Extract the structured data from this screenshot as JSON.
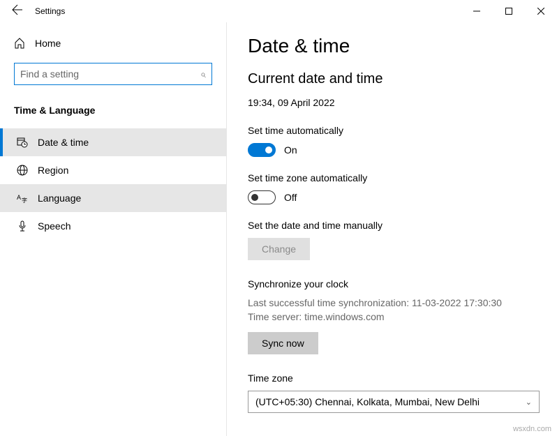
{
  "titlebar": {
    "title": "Settings"
  },
  "sidebar": {
    "home": "Home",
    "search_placeholder": "Find a setting",
    "group": "Time & Language",
    "items": [
      {
        "label": "Date & time"
      },
      {
        "label": "Region"
      },
      {
        "label": "Language"
      },
      {
        "label": "Speech"
      }
    ]
  },
  "main": {
    "heading": "Date & time",
    "subheading": "Current date and time",
    "datetime": "19:34, 09 April 2022",
    "set_time_auto_label": "Set time automatically",
    "set_time_auto_state": "On",
    "set_tz_auto_label": "Set time zone automatically",
    "set_tz_auto_state": "Off",
    "manual_label": "Set the date and time manually",
    "change_btn": "Change",
    "sync_heading": "Synchronize your clock",
    "sync_last": "Last successful time synchronization: 11-03-2022 17:30:30",
    "sync_server": "Time server: time.windows.com",
    "sync_btn": "Sync now",
    "tz_label": "Time zone",
    "tz_value": "(UTC+05:30) Chennai, Kolkata, Mumbai, New Delhi"
  },
  "watermark": "wsxdn.com"
}
